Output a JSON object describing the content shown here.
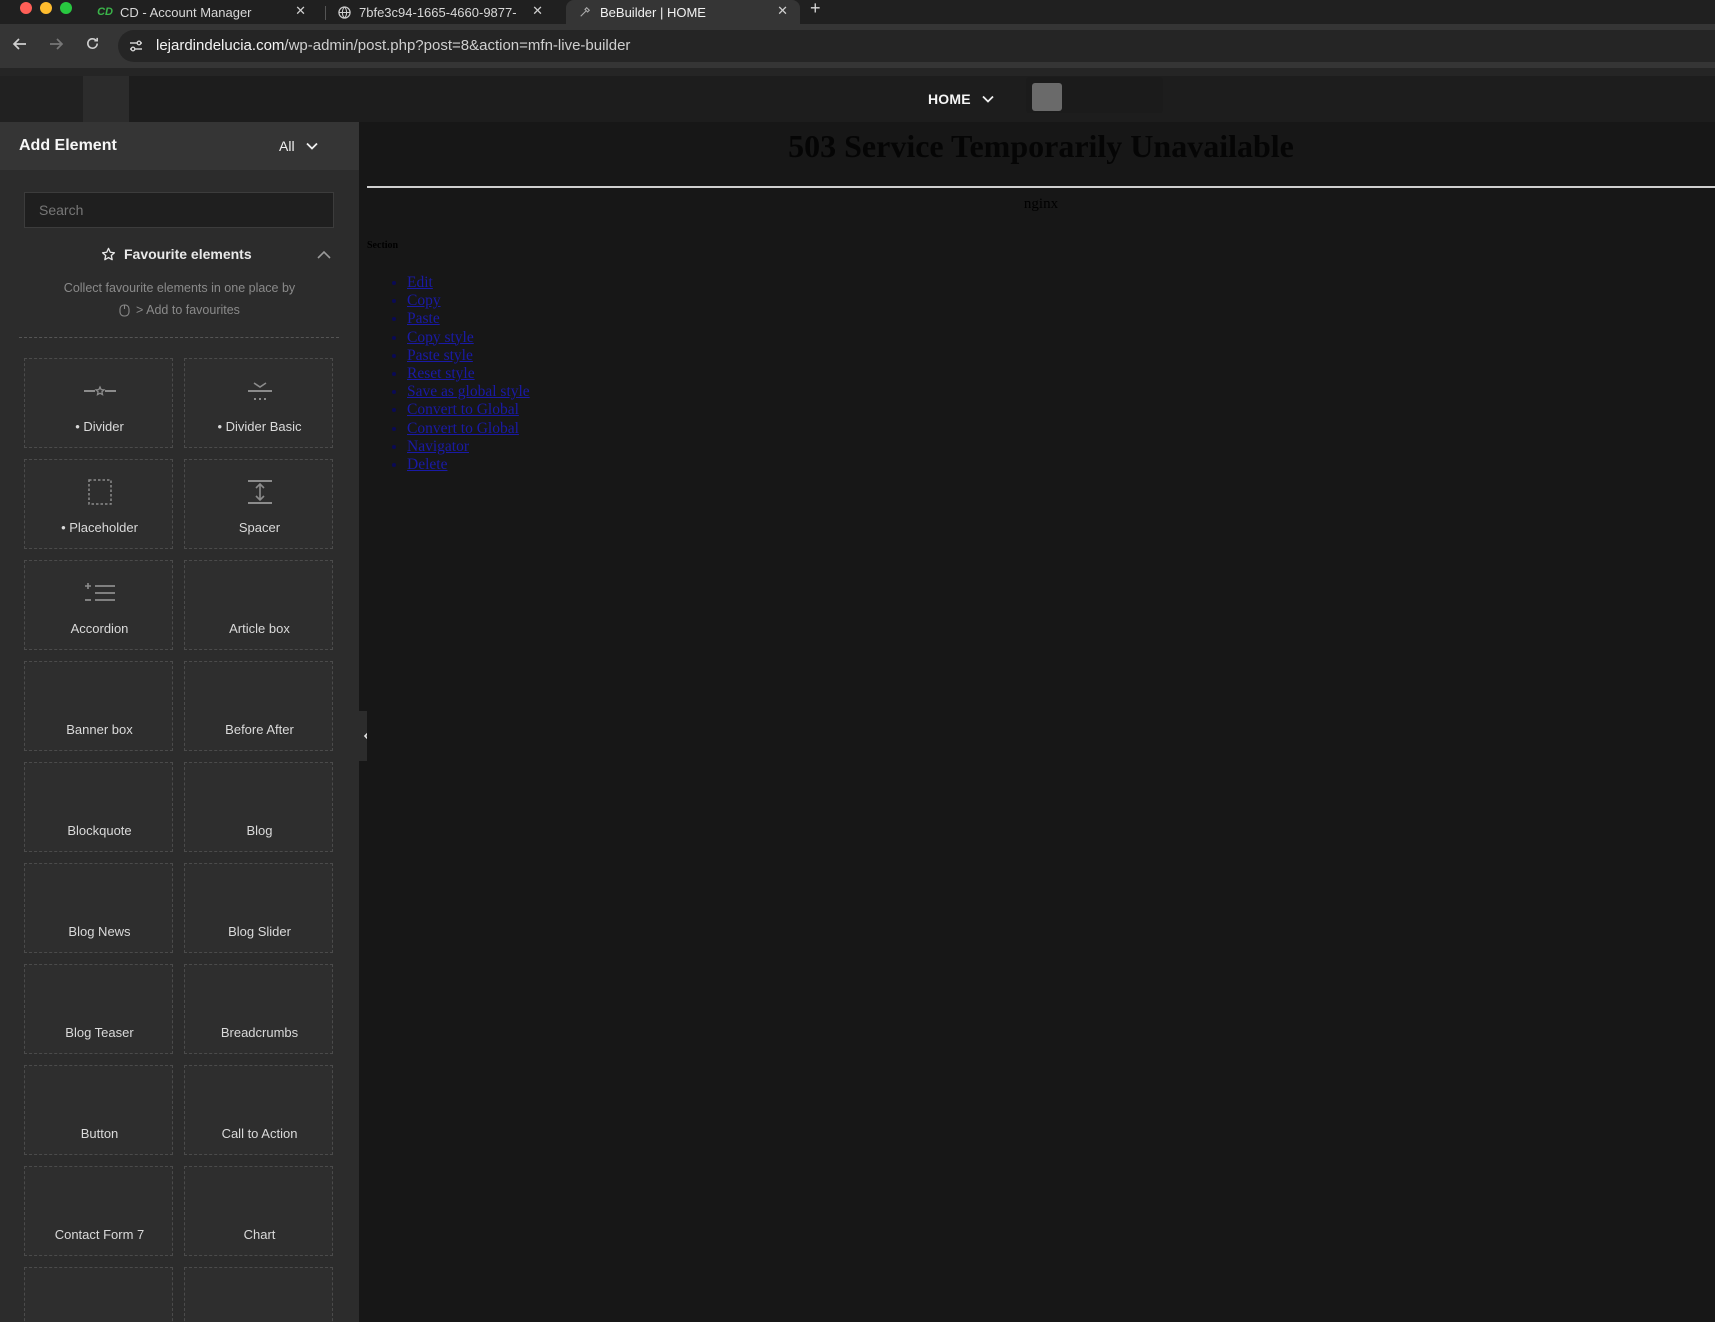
{
  "browser": {
    "tabs": [
      {
        "label": "CD - Account Manager",
        "icon": "cd-logo-icon",
        "active": false
      },
      {
        "label": "7bfe3c94-1665-4660-9877-",
        "icon": "globe-icon",
        "active": false
      },
      {
        "label": "BeBuilder | HOME",
        "icon": "bebuilder-icon",
        "active": true
      }
    ],
    "url_host": "lejardindelucia.com",
    "url_path": "/wp-admin/post.php?post=8&action=mfn-live-builder",
    "colors": {
      "close": "#ff5f57",
      "minimize": "#febc2e",
      "maximize": "#28c840"
    }
  },
  "builder": {
    "page_selector": "HOME"
  },
  "sidebar": {
    "title": "Add Element",
    "filter": "All",
    "search_placeholder": "Search",
    "favourites": {
      "title": "Favourite elements",
      "desc_line1": "Collect favourite elements in one place by",
      "desc_line2": "> Add to favourites"
    },
    "elements": [
      {
        "label": "• Divider",
        "icon": "divider-icon"
      },
      {
        "label": "• Divider Basic",
        "icon": "divider-basic-icon"
      },
      {
        "label": "• Placeholder",
        "icon": "placeholder-icon"
      },
      {
        "label": "Spacer",
        "icon": "spacer-icon"
      },
      {
        "label": "Accordion",
        "icon": "accordion-icon"
      },
      {
        "label": "Article box",
        "icon": ""
      },
      {
        "label": "Banner box",
        "icon": ""
      },
      {
        "label": "Before After",
        "icon": ""
      },
      {
        "label": "Blockquote",
        "icon": ""
      },
      {
        "label": "Blog",
        "icon": ""
      },
      {
        "label": "Blog News",
        "icon": ""
      },
      {
        "label": "Blog Slider",
        "icon": ""
      },
      {
        "label": "Blog Teaser",
        "icon": ""
      },
      {
        "label": "Breadcrumbs",
        "icon": ""
      },
      {
        "label": "Button",
        "icon": ""
      },
      {
        "label": "Call to Action",
        "icon": ""
      },
      {
        "label": "Contact Form 7",
        "icon": ""
      },
      {
        "label": "Chart",
        "icon": ""
      },
      {
        "label": "",
        "icon": ""
      },
      {
        "label": "",
        "icon": ""
      }
    ]
  },
  "canvas": {
    "error_title": "503 Service Temporarily Unavailable",
    "server": "nginx",
    "section_label": "Section",
    "menu_items": [
      "Edit",
      "Copy",
      "Paste",
      "Copy style",
      "Paste style",
      "Reset style",
      "Save as global style",
      "Convert to Global",
      "Convert to Global",
      "Navigator",
      "Delete"
    ]
  }
}
